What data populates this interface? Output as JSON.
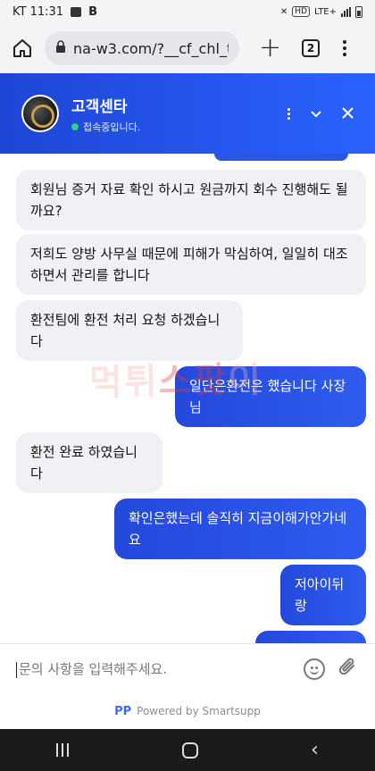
{
  "statusbar": {
    "carrier_time": "KT 11:31",
    "network": "LTE+"
  },
  "browser": {
    "url": "na-w3.com/?__cf_chl_t",
    "tab_count": "2"
  },
  "chat_header": {
    "title": "고객센타",
    "status": "접속중입니다."
  },
  "messages": [
    {
      "from": "agent",
      "text": "회원님 증거 자료 확인 하시고 원금까지 회수 진행해도 될까요?"
    },
    {
      "from": "agent",
      "text": "저희도 양방 사무실 때문에 피해가 막심하여, 일일히 대조하면서 관리를 합니다"
    },
    {
      "from": "agent",
      "text": "환전팀에 환전 처리 요청 하겠습니다"
    },
    {
      "from": "user",
      "text": "일단은환전은 했습니다 사장님"
    },
    {
      "from": "agent",
      "text": "환전 완료 하였습니다"
    },
    {
      "from": "user",
      "text": "확인은했는데 솔직히 지금이해가안가네요"
    },
    {
      "from": "user",
      "text": "저아이뒤랑"
    }
  ],
  "watermark": {
    "part1": "먹튀",
    "part2": "스팟",
    "part3": "이"
  },
  "input": {
    "placeholder": "문의 사항을 입력해주세요."
  },
  "footer": {
    "logo": "PP",
    "powered_by": "Powered by Smartsupp"
  },
  "colors": {
    "accent": "#2a57e8",
    "agent_bubble": "#f0f1f4",
    "online": "#2ee07a"
  }
}
